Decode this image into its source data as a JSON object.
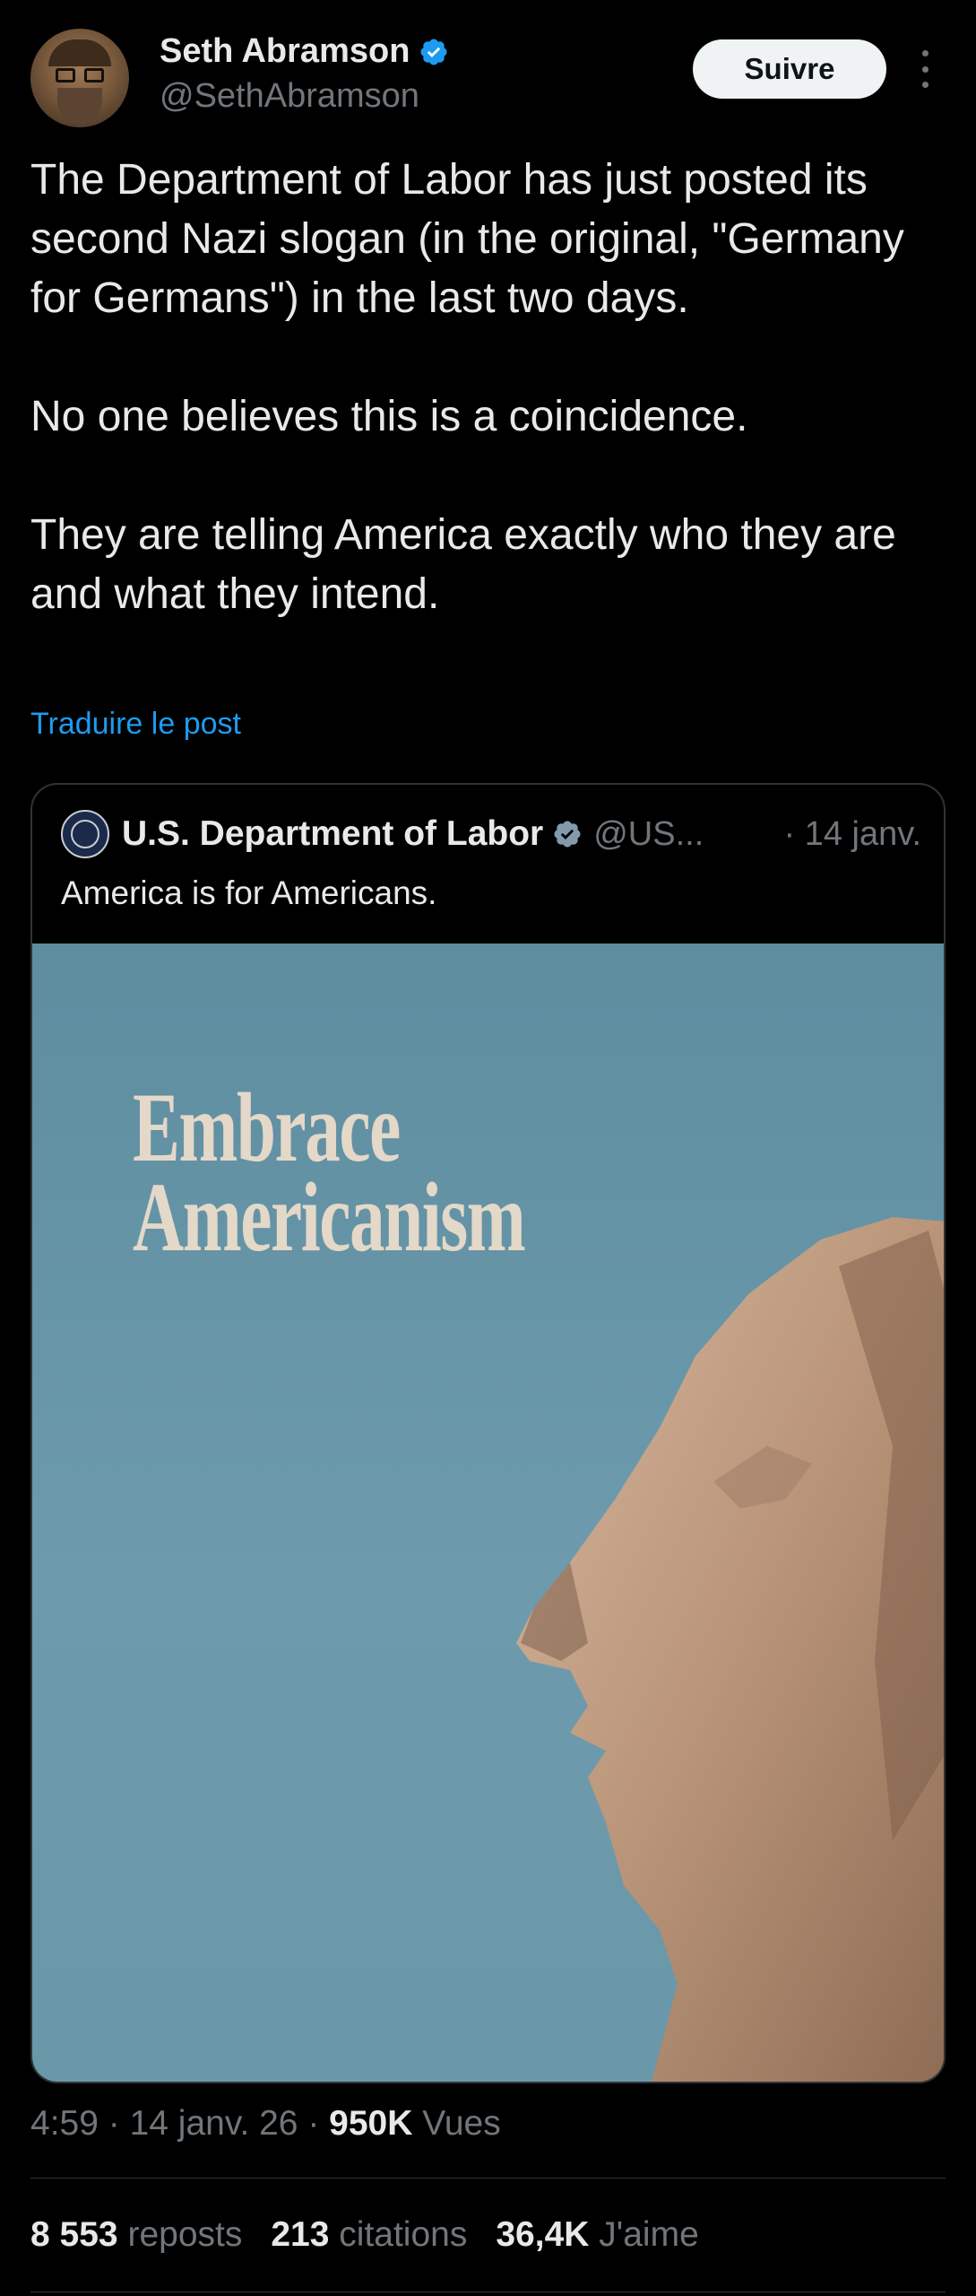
{
  "author": {
    "name": "Seth Abramson",
    "handle": "@SethAbramson",
    "verified": true,
    "avatar": "avatar"
  },
  "follow_button": {
    "label": "Suivre"
  },
  "more_icon": "more-vertical-icon",
  "tweet": {
    "paragraphs": [
      "The Department of Labor has just posted its second Nazi slogan (in the original, \"Germany for Germans\") in the last two days.",
      "No one believes this is a coincidence.",
      "They are telling America exactly who they are and what they intend."
    ],
    "translate_label": "Traduire le post"
  },
  "quoted": {
    "name": "U.S. Department of Labor",
    "verified": true,
    "handle": "@US...",
    "date": "· 14 janv.",
    "text": "America is for Americans.",
    "media": {
      "headline_line1": "Embrace",
      "headline_line2": "Americanism"
    }
  },
  "meta": {
    "time": "4:59",
    "date": "14 janv. 26",
    "views_count": "950K",
    "views_label": "Vues"
  },
  "stats": {
    "reposts_count": "8 553",
    "reposts_label": "reposts",
    "quotes_count": "213",
    "quotes_label": "citations",
    "likes_count": "36,4K",
    "likes_label": "J'aime"
  },
  "colors": {
    "background": "#000000",
    "text": "#e7e9ea",
    "secondary": "#71767b",
    "link": "#1d9bf0",
    "verified": "#1d9bf0"
  }
}
